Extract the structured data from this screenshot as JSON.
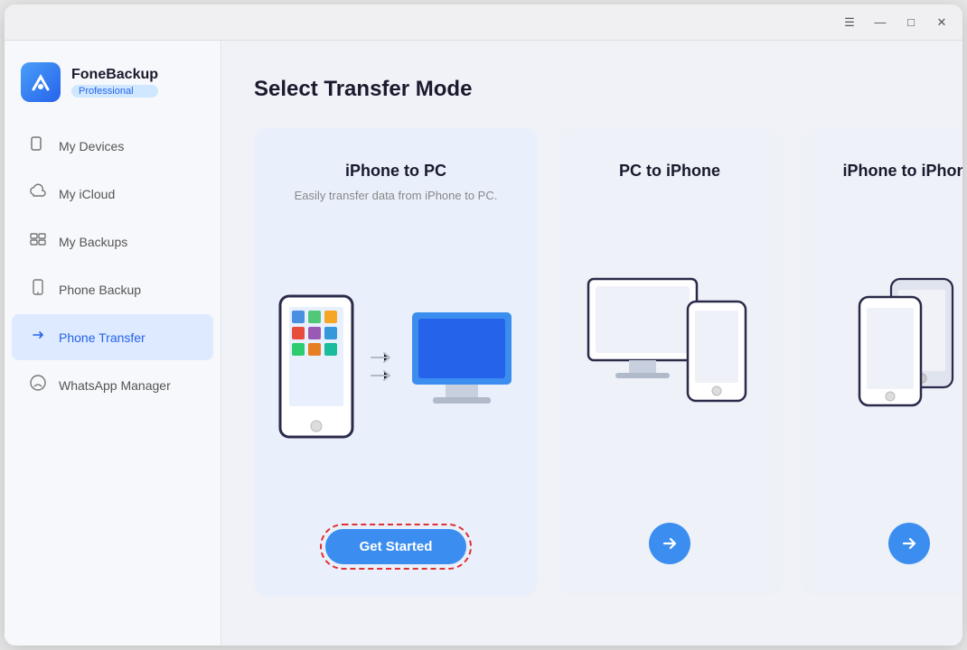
{
  "window": {
    "title": "FoneBackup Professional"
  },
  "titlebar": {
    "menu_icon": "☰",
    "minimize_icon": "—",
    "maximize_icon": "□",
    "close_icon": "✕"
  },
  "sidebar": {
    "logo": {
      "name": "FoneBackup",
      "badge": "Professional"
    },
    "items": [
      {
        "id": "my-devices",
        "label": "My Devices",
        "icon": "📱",
        "active": false
      },
      {
        "id": "my-icloud",
        "label": "My iCloud",
        "icon": "☁",
        "active": false
      },
      {
        "id": "my-backups",
        "label": "My Backups",
        "icon": "⊞",
        "active": false
      },
      {
        "id": "phone-backup",
        "label": "Phone Backup",
        "icon": "□",
        "active": false
      },
      {
        "id": "phone-transfer",
        "label": "Phone Transfer",
        "icon": "→",
        "active": true
      },
      {
        "id": "whatsapp-manager",
        "label": "WhatsApp Manager",
        "icon": "◯",
        "active": false
      }
    ]
  },
  "main": {
    "page_title": "Select Transfer Mode",
    "cards": [
      {
        "id": "iphone-to-pc",
        "title": "iPhone to PC",
        "desc": "Easily transfer data from iPhone to PC.",
        "action_label": "Get Started",
        "action_type": "button"
      },
      {
        "id": "pc-to-iphone",
        "title": "PC to iPhone",
        "desc": "",
        "action_label": "→",
        "action_type": "arrow"
      },
      {
        "id": "iphone-to-iphone",
        "title": "iPhone to iPhone",
        "desc": "",
        "action_label": "→",
        "action_type": "arrow"
      }
    ]
  }
}
